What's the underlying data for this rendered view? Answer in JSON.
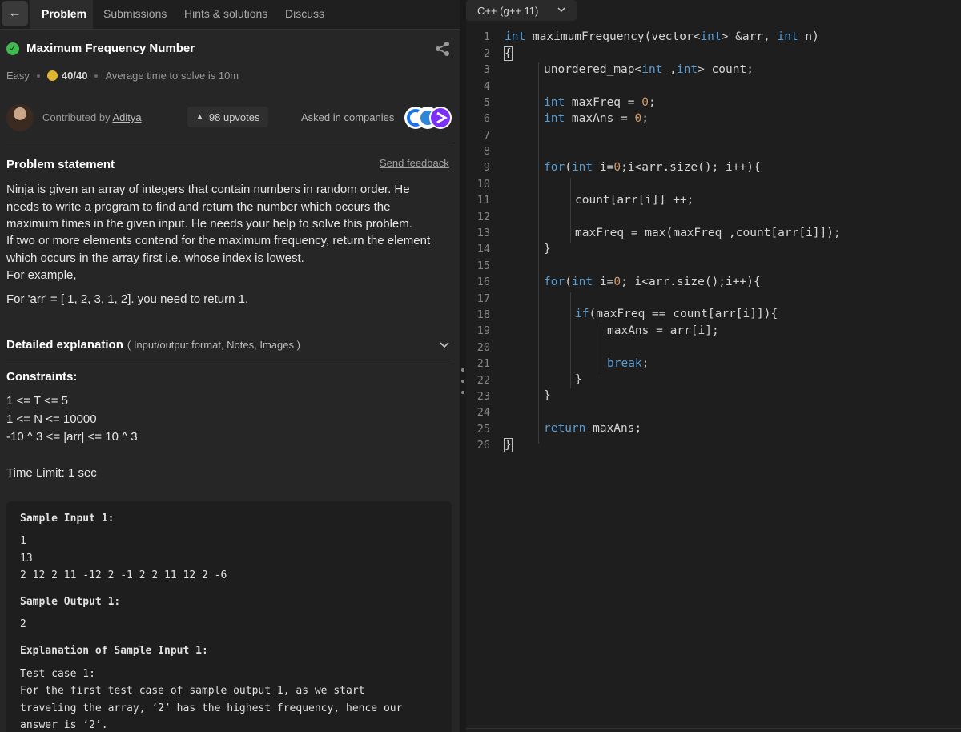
{
  "tabs": {
    "back_icon": "arrow-left-icon",
    "items": [
      "Problem",
      "Submissions",
      "Hints & solutions",
      "Discuss"
    ]
  },
  "problem": {
    "title": "Maximum Frequency Number",
    "difficulty": "Easy",
    "score": "40/40",
    "avg_time": "Average time to solve is 10m",
    "contributed_prefix": "Contributed by",
    "contributor": "Aditya",
    "upvotes": "98 upvotes",
    "asked_in": "Asked in companies",
    "statement_heading": "Problem statement",
    "send_feedback": "Send feedback",
    "statement_lines": [
      "Ninja is given an array of integers that contain numbers in random order. He",
      "needs to write a program to find and return the number which occurs the",
      "maximum times in the given input. He needs your help to solve this problem.",
      "If two or more elements contend for the maximum frequency, return the element",
      "which occurs in the array first i.e. whose index is lowest.",
      "For example,"
    ],
    "example": "For 'arr' = [ 1, 2, 3, 1, 2]. you need to return 1.",
    "detailed_heading": "Detailed explanation",
    "detailed_sub": "( Input/output format, Notes, Images )",
    "constraints_heading": "Constraints:",
    "constraints": [
      "1 <= T <= 5",
      "1 <= N <= 10000",
      "-10 ^ 3 <= |arr| <= 10 ^ 3"
    ],
    "time_limit": "Time Limit: 1 sec"
  },
  "sample": {
    "input_heading": "Sample Input 1:",
    "input_lines": [
      "1",
      "13",
      "2 12 2 11 -12 2 -1 2 2 11 12 2 -6"
    ],
    "output_heading": "Sample Output 1:",
    "output": "2",
    "explanation_heading": "Explanation of Sample Input 1:",
    "explanation_lines": [
      "Test case 1:",
      "For the first test case of sample output 1, as we start",
      "traveling the array, ‘2’ has the highest frequency, hence our",
      "answer is ‘2’."
    ]
  },
  "editor": {
    "language": "C++ (g++ 11)",
    "line_numbers": [
      "1",
      "2",
      "3",
      "4",
      "5",
      "6",
      "7",
      "8",
      "9",
      "10",
      "11",
      "12",
      "13",
      "14",
      "15",
      "16",
      "17",
      "18",
      "19",
      "20",
      "21",
      "22",
      "23",
      "24",
      "25",
      "26"
    ],
    "code": {
      "l1a": "int",
      "l1b": " maximumFrequency(vector<",
      "l1c": "int",
      "l1d": "> &arr, ",
      "l1e": "int",
      "l1f": " n)",
      "l2": "{",
      "l3a": "unordered_map<",
      "l3b": "int",
      "l3c": " ,",
      "l3d": "int",
      "l3e": "> count;",
      "l5a": "int",
      "l5b": " maxFreq = ",
      "l5c": "0",
      "l5d": ";",
      "l6a": "int",
      "l6b": " maxAns = ",
      "l6c": "0",
      "l6d": ";",
      "l9a": "for",
      "l9b": "(",
      "l9c": "int",
      "l9d": " i=",
      "l9e": "0",
      "l9f": ";i<arr.size(); i++){",
      "l11": "count[arr[i]] ++;",
      "l13": "maxFreq = max(maxFreq ,count[arr[i]]);",
      "l14": "}",
      "l16a": "for",
      "l16b": "(",
      "l16c": "int",
      "l16d": " i=",
      "l16e": "0",
      "l16f": "; i<arr.size();i++){",
      "l18a": "if",
      "l18b": "(maxFreq == count[arr[i]]){",
      "l19": "maxAns = arr[i];",
      "l21": "break",
      "l21b": ";",
      "l22": "}",
      "l23": "}",
      "l25a": "return",
      "l25b": " maxAns;",
      "l26": "}"
    }
  },
  "colors": {
    "check": "#3fb950",
    "keyword": "#569cd6",
    "number": "#d19a66"
  }
}
